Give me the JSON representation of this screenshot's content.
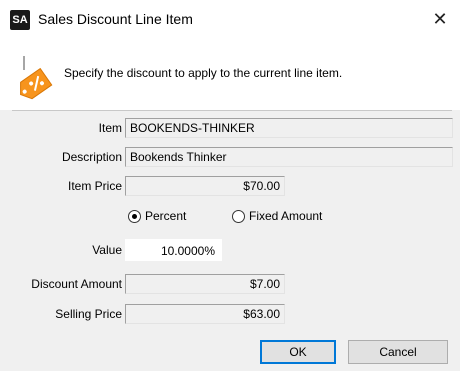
{
  "window": {
    "app_icon_text": "SA",
    "title": "Sales Discount Line Item",
    "close_glyph": "✕"
  },
  "header": {
    "icon": "discount-tag-icon",
    "instruction": "Specify the discount to apply to the current line item."
  },
  "fields": {
    "item_label": "Item",
    "item_value": "BOOKENDS-THINKER",
    "description_label": "Description",
    "description_value": "Bookends Thinker",
    "item_price_label": "Item Price",
    "item_price_value": "$70.00",
    "value_label": "Value",
    "value_value": "10.0000%",
    "discount_amount_label": "Discount Amount",
    "discount_amount_value": "$7.00",
    "selling_price_label": "Selling Price",
    "selling_price_value": "$63.00"
  },
  "discount_type": {
    "percent_label": "Percent",
    "fixed_label": "Fixed Amount",
    "selected": "percent"
  },
  "buttons": {
    "ok": "OK",
    "cancel": "Cancel"
  },
  "colors": {
    "tag_orange": "#f7941d",
    "primary_border": "#0078d7"
  }
}
